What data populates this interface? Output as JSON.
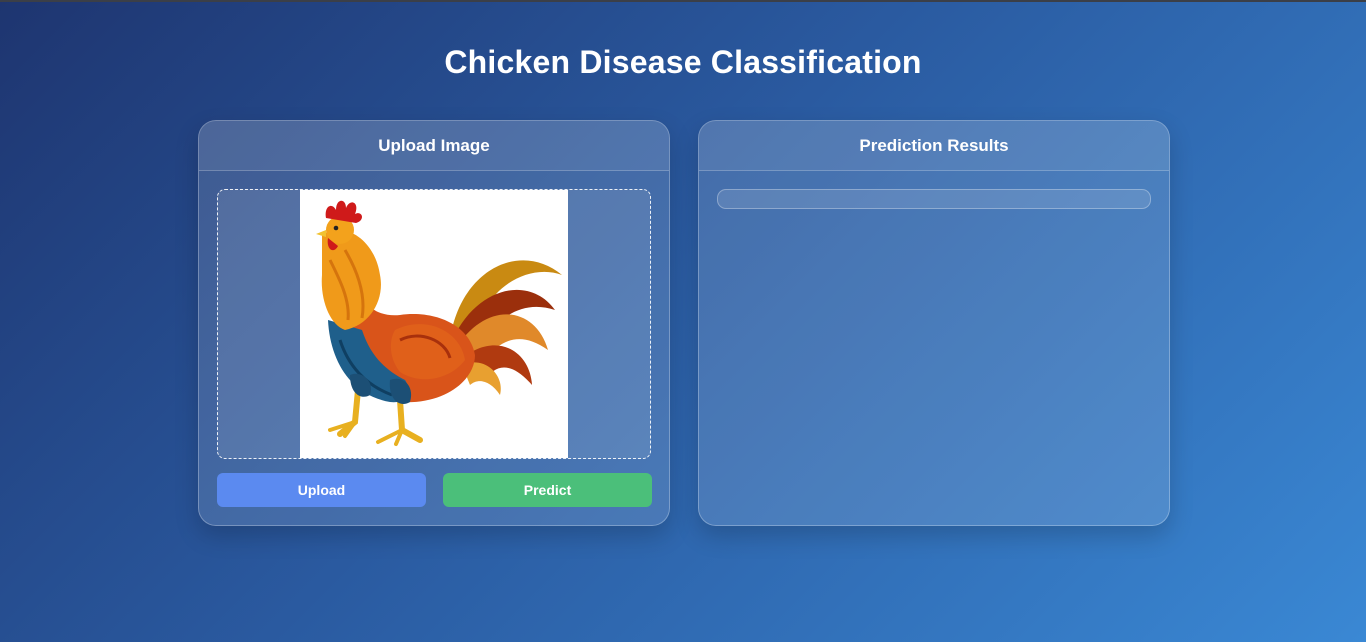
{
  "page": {
    "title": "Chicken Disease Classification"
  },
  "upload_panel": {
    "header": "Upload Image",
    "preview_image": "rooster illustration",
    "upload_button_label": "Upload",
    "predict_button_label": "Predict"
  },
  "results_panel": {
    "header": "Prediction Results",
    "result_text": ""
  },
  "colors": {
    "upload_button": "#5b8af0",
    "predict_button": "#4bbf7a",
    "background_start": "#1e3570",
    "background_end": "#3a88d4"
  }
}
